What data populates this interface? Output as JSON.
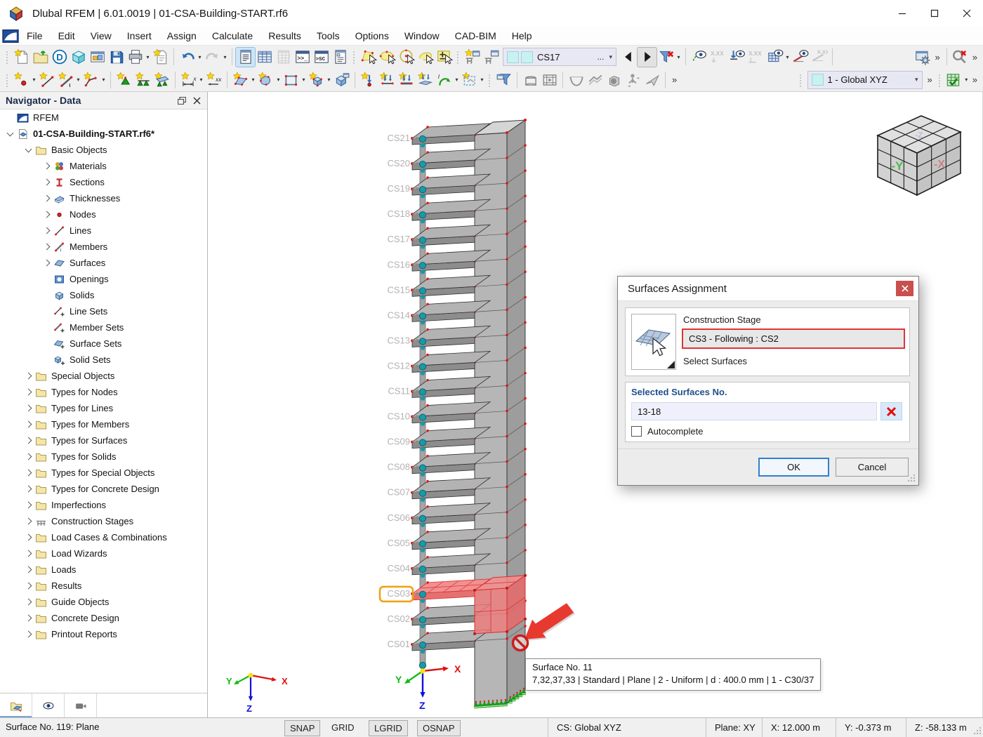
{
  "window": {
    "title": "Dlubal RFEM | 6.01.0019 | 01-CSA-Building-START.rf6",
    "minimize": "minimize",
    "maximize": "maximize",
    "close": "close"
  },
  "menu": {
    "items": [
      "File",
      "Edit",
      "View",
      "Insert",
      "Assign",
      "Calculate",
      "Results",
      "Tools",
      "Options",
      "Window",
      "CAD-BIM",
      "Help"
    ]
  },
  "toolbar1": [
    {
      "t": "h"
    },
    {
      "t": "i",
      "n": "new-model-icon",
      "k": "page-star"
    },
    {
      "t": "i",
      "n": "open-model-icon",
      "k": "folder-open"
    },
    {
      "t": "i",
      "n": "dlubal-center-icon",
      "k": "dlubal-d"
    },
    {
      "t": "i",
      "n": "model-cube-icon",
      "k": "cube-cyan"
    },
    {
      "t": "i",
      "n": "project-administration-icon",
      "k": "window-pic"
    },
    {
      "t": "i",
      "n": "save-icon",
      "k": "floppy"
    },
    {
      "t": "i",
      "n": "print-icon",
      "k": "printer",
      "dd": 1
    },
    {
      "t": "i",
      "n": "new-printout-report-icon",
      "k": "page-star2"
    },
    {
      "t": "s"
    },
    {
      "t": "i",
      "n": "undo-icon",
      "k": "undo",
      "dd": 1
    },
    {
      "t": "i",
      "n": "redo-icon",
      "k": "redo",
      "dd": 1,
      "dim": 1
    },
    {
      "t": "s"
    },
    {
      "t": "i",
      "n": "navigator-toggle-icon",
      "k": "panel-list",
      "active": 1
    },
    {
      "t": "i",
      "n": "tables-icon",
      "k": "grid-blue"
    },
    {
      "t": "i",
      "n": "table-manager-icon",
      "k": "grid-dim",
      "dim": 1
    },
    {
      "t": "i",
      "n": "console-icon",
      "k": "console"
    },
    {
      "t": "i",
      "n": "script-console-icon",
      "k": "console2"
    },
    {
      "t": "i",
      "n": "panel-manager-icon",
      "k": "panel-list2"
    },
    {
      "t": "h"
    },
    {
      "t": "i",
      "n": "select-polygon-icon",
      "k": "sel-poly"
    },
    {
      "t": "i",
      "n": "select-ellipse-icon",
      "k": "sel-ellipse"
    },
    {
      "t": "i",
      "n": "select-circle-icon",
      "k": "sel-circle"
    },
    {
      "t": "i",
      "n": "select-lasso-icon",
      "k": "sel-lasso"
    },
    {
      "t": "i",
      "n": "select-plus-minus-icon",
      "k": "sel-pm"
    },
    {
      "t": "h"
    },
    {
      "t": "i",
      "n": "new-construction-stage-icon",
      "k": "cs-new"
    },
    {
      "t": "i",
      "n": "edit-construction-stage-icon",
      "k": "cs-edit"
    },
    {
      "t": "cs",
      "n": "construction-stage-combo"
    },
    {
      "t": "i",
      "n": "previous-stage-icon",
      "k": "arrow-left"
    },
    {
      "t": "i",
      "n": "next-stage-icon",
      "k": "arrow-right",
      "active2": 1
    },
    {
      "t": "i",
      "n": "filter-off-icon",
      "k": "funnel-x",
      "dd": 1
    },
    {
      "t": "s"
    },
    {
      "t": "i",
      "n": "numbering-visibility-icon",
      "k": "eye-number"
    },
    {
      "t": "i",
      "n": "numbering-values-icon",
      "k": "xxx1",
      "dim": 1
    },
    {
      "t": "i",
      "n": "supports-visibility-icon",
      "k": "support-eye"
    },
    {
      "t": "i",
      "n": "supports-values-icon",
      "k": "xxx2",
      "dim": 1
    },
    {
      "t": "i",
      "n": "mesh-visibility-icon",
      "k": "grid-eye",
      "dd": 1
    },
    {
      "t": "i",
      "n": "slope-visibility-icon",
      "k": "slope-eye"
    },
    {
      "t": "i",
      "n": "slope-values-icon",
      "k": "slope-xx",
      "dim": 1
    },
    {
      "t": "s"
    },
    {
      "t": "p"
    },
    {
      "t": "i",
      "n": "display-properties-icon",
      "k": "panel-gear"
    },
    {
      "t": "x",
      "n": "more-view-tools-chevron"
    },
    {
      "t": "s"
    },
    {
      "t": "i",
      "n": "find-deactivate-icon",
      "k": "find-x"
    },
    {
      "t": "x",
      "n": "more-find-tools-chevron"
    }
  ],
  "toolbar2": [
    {
      "t": "h"
    },
    {
      "t": "i",
      "n": "new-node-icon",
      "k": "node-new",
      "dd": 1
    },
    {
      "t": "i",
      "n": "new-line-icon",
      "k": "line-new"
    },
    {
      "t": "i",
      "n": "new-member-icon",
      "k": "member-new",
      "dd": 1
    },
    {
      "t": "i",
      "n": "new-polyline-icon",
      "k": "polyline-new",
      "dd": 1
    },
    {
      "t": "s"
    },
    {
      "t": "i",
      "n": "new-nodal-support-icon",
      "k": "support-nodal"
    },
    {
      "t": "i",
      "n": "new-line-support-icon",
      "k": "support-line"
    },
    {
      "t": "i",
      "n": "new-surface-support-icon",
      "k": "support-surface"
    },
    {
      "t": "s"
    },
    {
      "t": "i",
      "n": "new-dimension-icon",
      "k": "dim-x",
      "dd": 1
    },
    {
      "t": "i",
      "n": "new-dimension-xx-icon",
      "k": "dim-xx"
    },
    {
      "t": "s"
    },
    {
      "t": "i",
      "n": "new-surface-icon",
      "k": "surface-new",
      "dd": 1
    },
    {
      "t": "i",
      "n": "new-opening-icon",
      "k": "opening-new",
      "dd": 1
    },
    {
      "t": "i",
      "n": "new-rectangle-icon",
      "k": "rect-new",
      "dd": 1
    },
    {
      "t": "i",
      "n": "new-solid-icon",
      "k": "solid-new",
      "dd": 1
    },
    {
      "t": "i",
      "n": "new-block-icon",
      "k": "block-new"
    },
    {
      "t": "s"
    },
    {
      "t": "i",
      "n": "new-nodal-load-icon",
      "k": "load-nodal"
    },
    {
      "t": "i",
      "n": "new-line-load-icon",
      "k": "load-line"
    },
    {
      "t": "i",
      "n": "new-member-load-icon",
      "k": "load-member"
    },
    {
      "t": "i",
      "n": "new-surface-load-icon",
      "k": "load-surface"
    },
    {
      "t": "i",
      "n": "new-imperfection-icon",
      "k": "imperf",
      "dd": 1
    },
    {
      "t": "i",
      "n": "load-generation-icon",
      "k": "load-gen",
      "dd": 1
    },
    {
      "t": "h"
    },
    {
      "t": "i",
      "n": "filter-panel-icon",
      "k": "funnel-panel"
    },
    {
      "t": "s"
    },
    {
      "t": "i",
      "n": "clipping-box-icon",
      "k": "clip-box"
    },
    {
      "t": "i",
      "n": "walkthrough-icon",
      "k": "walkthrough"
    },
    {
      "t": "s"
    },
    {
      "t": "i",
      "n": "results-deformation-icon",
      "k": "result-curve"
    },
    {
      "t": "i",
      "n": "results-surfaces-icon",
      "k": "result-surface"
    },
    {
      "t": "i",
      "n": "results-solids-icon",
      "k": "result-solid"
    },
    {
      "t": "i",
      "n": "results-person-icon",
      "k": "result-person"
    },
    {
      "t": "i",
      "n": "results-fly-icon",
      "k": "result-fly"
    },
    {
      "t": "s"
    },
    {
      "t": "x",
      "n": "more-results-chevron"
    },
    {
      "t": "p"
    },
    {
      "t": "h"
    },
    {
      "t": "ax",
      "n": "coordinate-system-combo"
    },
    {
      "t": "x",
      "n": "more-cs-chevron"
    },
    {
      "t": "h"
    },
    {
      "t": "i",
      "n": "calculation-icon",
      "k": "calc-grid",
      "dd": 1
    },
    {
      "t": "x",
      "n": "more-calc-chevron"
    }
  ],
  "cs_combo": {
    "value": "CS17",
    "more": "...",
    "accent": "#c6f2f2"
  },
  "axes_combo": {
    "value": "1 - Global XYZ"
  },
  "chevron_glyph": "»",
  "navigator": {
    "title": "Navigator - Data",
    "tree": [
      {
        "l": "RFEM",
        "i": "rfem",
        "d": 0,
        "a": 0
      },
      {
        "l": "01-CSA-Building-START.rf6*",
        "i": "model",
        "d": 0,
        "a": 1,
        "b": 1
      },
      {
        "l": "Basic Objects",
        "i": "folder",
        "d": 1,
        "a": 1
      },
      {
        "l": "Materials",
        "i": "materials",
        "d": 2,
        "a": 2
      },
      {
        "l": "Sections",
        "i": "sections",
        "d": 2,
        "a": 2
      },
      {
        "l": "Thicknesses",
        "i": "thickness",
        "d": 2,
        "a": 2
      },
      {
        "l": "Nodes",
        "i": "node",
        "d": 2,
        "a": 2
      },
      {
        "l": "Lines",
        "i": "line",
        "d": 2,
        "a": 2
      },
      {
        "l": "Members",
        "i": "member",
        "d": 2,
        "a": 2
      },
      {
        "l": "Surfaces",
        "i": "surface",
        "d": 2,
        "a": 2
      },
      {
        "l": "Openings",
        "i": "opening",
        "d": 2,
        "a": 0
      },
      {
        "l": "Solids",
        "i": "solid",
        "d": 2,
        "a": 0
      },
      {
        "l": "Line Sets",
        "i": "lineset",
        "d": 2,
        "a": 0
      },
      {
        "l": "Member Sets",
        "i": "memberset",
        "d": 2,
        "a": 0
      },
      {
        "l": "Surface Sets",
        "i": "surfaceset",
        "d": 2,
        "a": 0
      },
      {
        "l": "Solid Sets",
        "i": "solidset",
        "d": 2,
        "a": 0
      },
      {
        "l": "Special Objects",
        "i": "folder",
        "d": 1,
        "a": 2
      },
      {
        "l": "Types for Nodes",
        "i": "folder",
        "d": 1,
        "a": 2
      },
      {
        "l": "Types for Lines",
        "i": "folder",
        "d": 1,
        "a": 2
      },
      {
        "l": "Types for Members",
        "i": "folder",
        "d": 1,
        "a": 2
      },
      {
        "l": "Types for Surfaces",
        "i": "folder",
        "d": 1,
        "a": 2
      },
      {
        "l": "Types for Solids",
        "i": "folder",
        "d": 1,
        "a": 2
      },
      {
        "l": "Types for Special Objects",
        "i": "folder",
        "d": 1,
        "a": 2
      },
      {
        "l": "Types for Concrete Design",
        "i": "folder",
        "d": 1,
        "a": 2
      },
      {
        "l": "Imperfections",
        "i": "folder",
        "d": 1,
        "a": 2
      },
      {
        "l": "Construction Stages",
        "i": "cstages",
        "d": 1,
        "a": 2
      },
      {
        "l": "Load Cases & Combinations",
        "i": "folder",
        "d": 1,
        "a": 2
      },
      {
        "l": "Load Wizards",
        "i": "folder",
        "d": 1,
        "a": 2
      },
      {
        "l": "Loads",
        "i": "folder",
        "d": 1,
        "a": 2
      },
      {
        "l": "Results",
        "i": "folder",
        "d": 1,
        "a": 2
      },
      {
        "l": "Guide Objects",
        "i": "folder",
        "d": 1,
        "a": 2
      },
      {
        "l": "Concrete Design",
        "i": "folder",
        "d": 1,
        "a": 2
      },
      {
        "l": "Printout Reports",
        "i": "folder",
        "d": 1,
        "a": 2
      }
    ],
    "tabs": [
      "data-tab",
      "views-tab",
      "visibilities-tab"
    ]
  },
  "scene": {
    "floors": [
      "CS21",
      "CS20",
      "CS19",
      "CS18",
      "CS17",
      "CS16",
      "CS15",
      "CS14",
      "CS13",
      "CS12",
      "CS11",
      "CS10",
      "CS09",
      "CS08",
      "CS07",
      "CS06",
      "CS05",
      "CS04",
      "CS03",
      "CS02",
      "CS01"
    ],
    "highlight": "CS03",
    "axis_labels": {
      "x": "X",
      "y": "Y",
      "z": "Z"
    },
    "cube_labels": {
      "left": "-Y",
      "right": "-X",
      "top": "-Z"
    },
    "colors": {
      "slab_top": "#b3b3b3",
      "slab_front": "#8d8d8d",
      "core_front": "#b6b6b6",
      "core_side": "#9d9d9d",
      "core_top": "#d5d5d5",
      "node": "#189aa8",
      "red_dot": "#e01818",
      "selection": "#ee7070",
      "selection_edge": "#d93030",
      "support": "#16a016",
      "highlight_box": "#f0a010",
      "arrow": "#e8392f"
    }
  },
  "tooltip": {
    "line1": "Surface No. 11",
    "line2": "7,32,37,33 | Standard | Plane | 2 - Uniform | d : 400.0 mm | 1 - C30/37"
  },
  "dialog": {
    "title": "Surfaces Assignment",
    "close": "x",
    "construction_stage_label": "Construction Stage",
    "stage_value": "CS3 - Following : CS2",
    "select_surfaces_label": "Select Surfaces",
    "selected_header": "Selected Surfaces No.",
    "surfaces_value": "13-18",
    "autocomplete_label": "Autocomplete",
    "ok_label": "OK",
    "cancel_label": "Cancel"
  },
  "statusbar": {
    "left": "Surface No. 119: Plane",
    "toggles": [
      {
        "label": "SNAP",
        "pressed": true
      },
      {
        "label": "GRID",
        "pressed": false
      },
      {
        "label": "LGRID",
        "pressed": true
      },
      {
        "label": "OSNAP",
        "pressed": true
      }
    ],
    "cs": "CS: Global XYZ",
    "plane": "Plane: XY",
    "x": "X: 12.000 m",
    "y": "Y: -0.373 m",
    "z": "Z: -58.133 m"
  }
}
